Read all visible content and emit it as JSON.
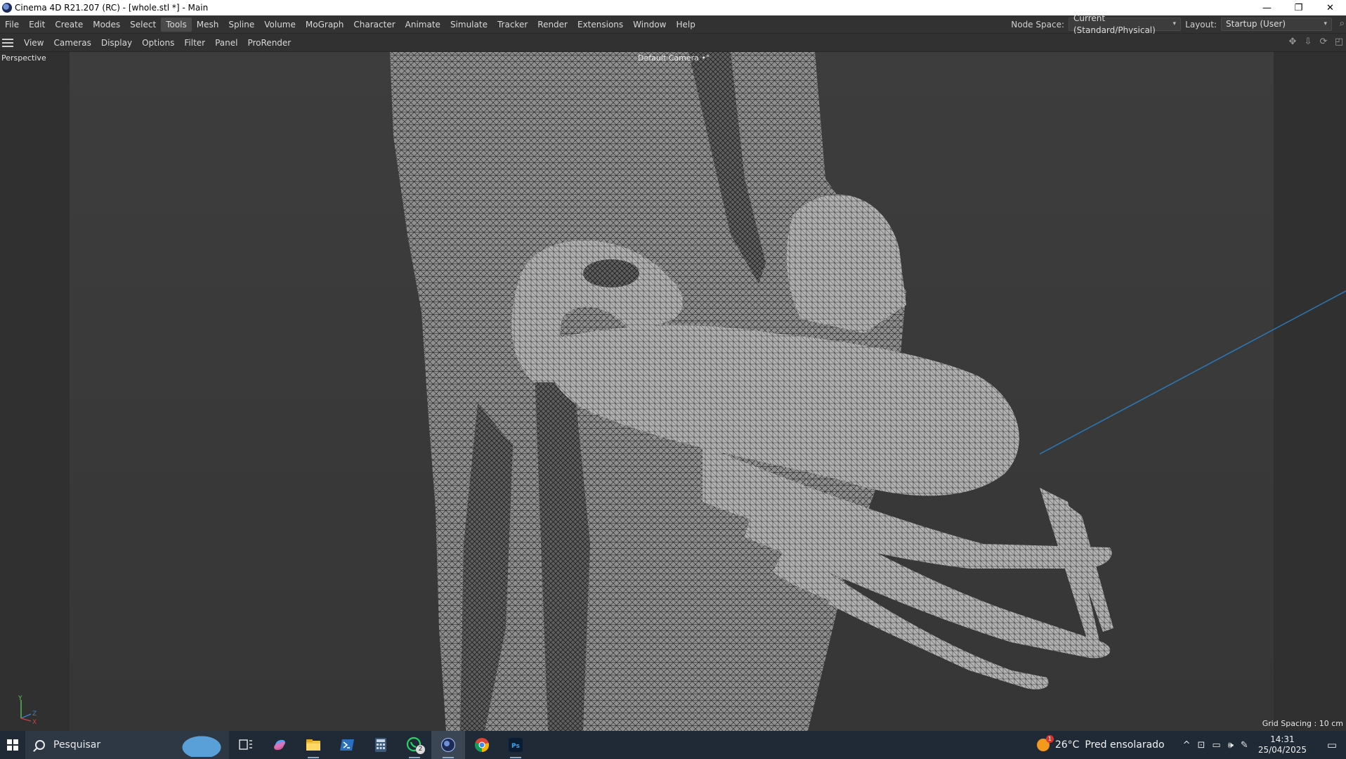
{
  "window": {
    "title": "Cinema 4D R21.207 (RC) - [whole.stl *] - Main",
    "controls": {
      "minimize": "—",
      "restore": "❐",
      "close": "✕"
    }
  },
  "menubar": {
    "items": [
      "File",
      "Edit",
      "Create",
      "Modes",
      "Select",
      "Tools",
      "Mesh",
      "Spline",
      "Volume",
      "MoGraph",
      "Character",
      "Animate",
      "Simulate",
      "Tracker",
      "Render",
      "Extensions",
      "Window",
      "Help"
    ],
    "active_item": "Tools",
    "node_space_label": "Node Space:",
    "node_space_value": "Current (Standard/Physical)",
    "layout_label": "Layout:",
    "layout_value": "Startup (User)"
  },
  "viewport_toolbar": {
    "items": [
      "View",
      "Cameras",
      "Display",
      "Options",
      "Filter",
      "Panel",
      "ProRender"
    ]
  },
  "viewport": {
    "view_name": "Perspective",
    "camera": "Default Camera",
    "camera_suffix": "•°",
    "grid_spacing": "Grid Spacing : 10 cm",
    "axis": {
      "y": "Y",
      "z": "Z",
      "x": "X"
    },
    "colors": {
      "background": "#3a3a3a",
      "side_panels": "#303030",
      "mesh": "#9a9a9a",
      "axis_line": "#2c79b8"
    }
  },
  "taskbar": {
    "search_placeholder": "Pesquisar",
    "whatsapp_badge": "2",
    "weather_temp": "26°C",
    "weather_desc": "Pred ensolarado",
    "weather_badge": "1",
    "time": "14:31",
    "date": "25/04/2025",
    "icons": [
      "task-view-icon",
      "copilot-icon",
      "file-explorer-icon",
      "powershell-icon",
      "calculator-icon",
      "whatsapp-icon",
      "cinema4d-icon",
      "chrome-icon",
      "photoshop-icon"
    ]
  }
}
